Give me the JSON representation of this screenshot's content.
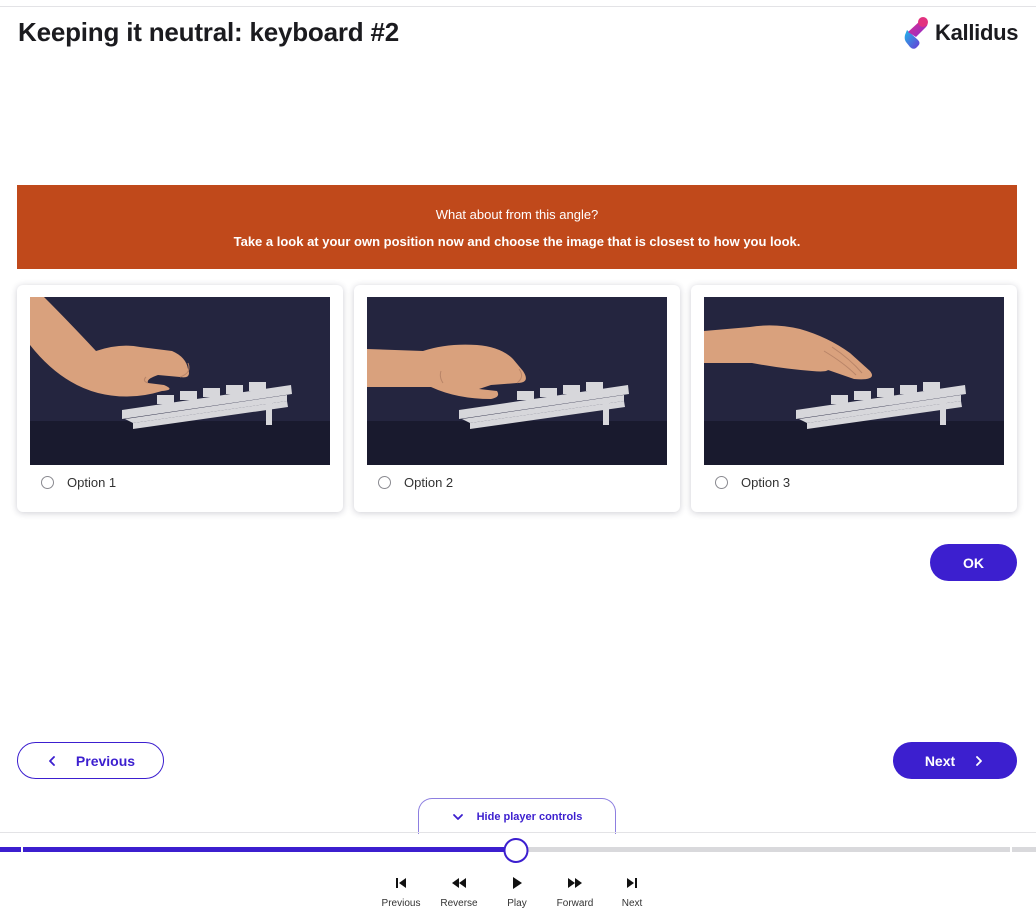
{
  "header": {
    "title": "Keeping it neutral: keyboard #2",
    "logo_text": "Kallidus"
  },
  "question": {
    "prompt": "What about from this angle?",
    "instruction": "Take a look at your own position now and choose the image that is closest to how you look."
  },
  "options": [
    {
      "label": "Option 1",
      "selected": false,
      "illustration": "hand-above-keyboard-wrist-raised"
    },
    {
      "label": "Option 2",
      "selected": false,
      "illustration": "hand-on-keyboard-wrist-level"
    },
    {
      "label": "Option 3",
      "selected": false,
      "illustration": "hand-above-keyboard-fingers-extended"
    }
  ],
  "actions": {
    "ok_label": "OK"
  },
  "navigation": {
    "previous_label": "Previous",
    "next_label": "Next"
  },
  "player": {
    "toggle_label": "Hide player controls",
    "progress": 0.5,
    "controls": [
      {
        "label": "Previous",
        "icon": "skip-back-icon"
      },
      {
        "label": "Reverse",
        "icon": "rewind-icon"
      },
      {
        "label": "Play",
        "icon": "play-icon"
      },
      {
        "label": "Forward",
        "icon": "fast-forward-icon"
      },
      {
        "label": "Next",
        "icon": "skip-forward-icon"
      }
    ]
  },
  "colors": {
    "brand": "#3c1fcf",
    "banner": "#c0491b",
    "scene_bg": "#24253f",
    "scene_floor": "#191a2e",
    "skin": "#d9a17d",
    "keyboard": "#d7d7db"
  }
}
